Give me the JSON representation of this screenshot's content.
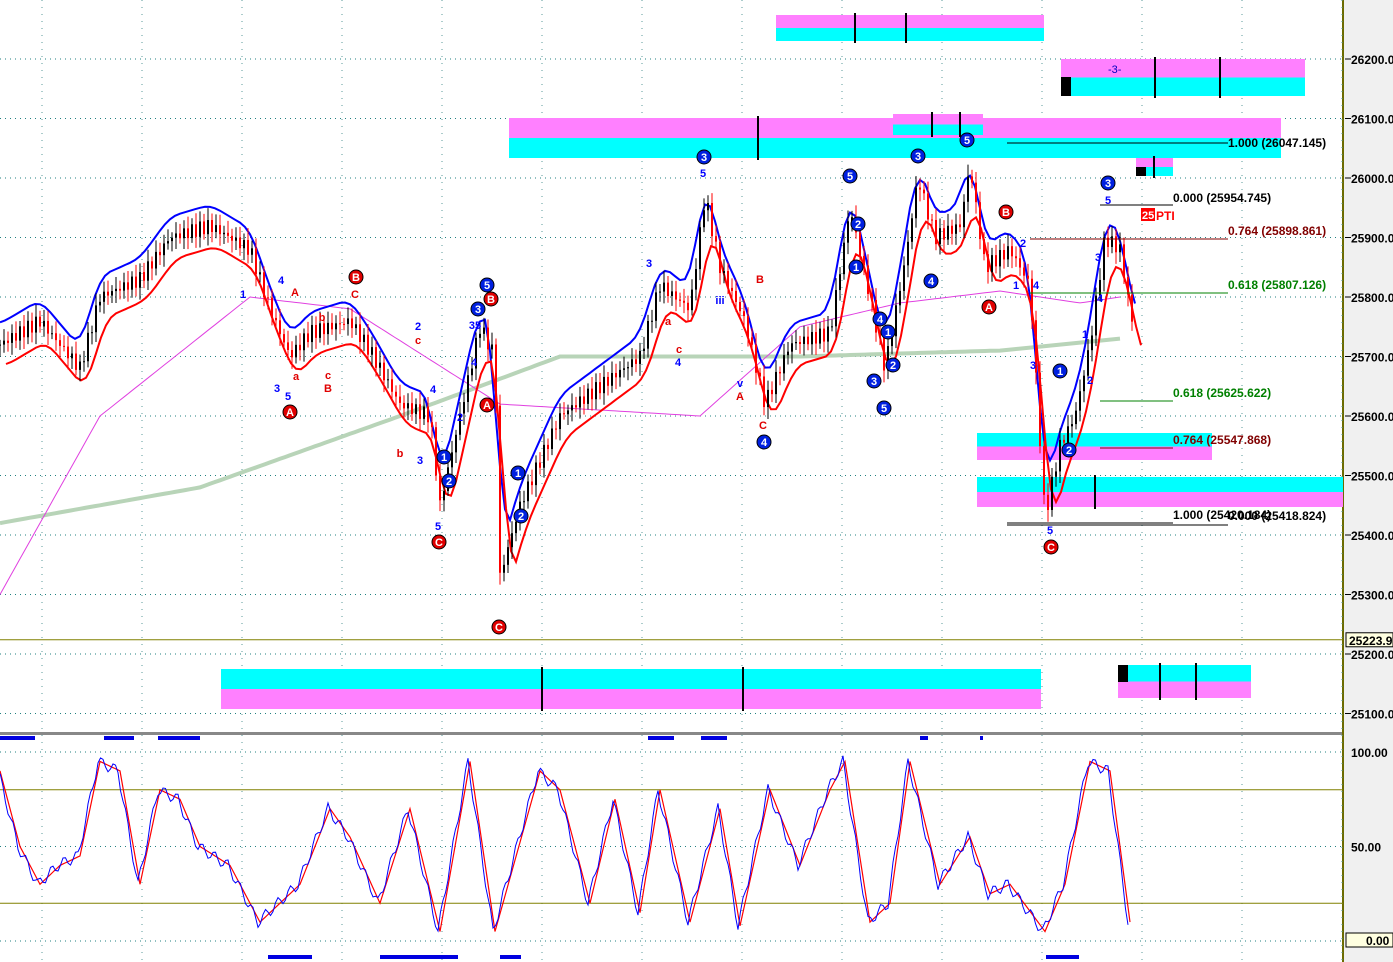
{
  "chart_data": {
    "type": "candlestick",
    "price_axis": {
      "ticks": [
        "26200.0",
        "26100.0",
        "26000.0",
        "25900.0",
        "25800.0",
        "25700.0",
        "25600.0",
        "25500.0",
        "25400.0",
        "25300.0",
        "25200.0",
        "25100.0"
      ],
      "tick_values": [
        26200,
        26100,
        26000,
        25900,
        25800,
        25700,
        25600,
        25500,
        25400,
        25300,
        25200,
        25100
      ],
      "last_price": "25223.9"
    },
    "osc_axis": {
      "ticks": [
        "100.00",
        "50.00"
      ],
      "tick_values": [
        100,
        50
      ],
      "last_value": "0.00",
      "levels": [
        80,
        20
      ]
    },
    "price_series": [
      [
        0,
        25720
      ],
      [
        4,
        25760
      ],
      [
        8,
        25680
      ],
      [
        10,
        25800
      ],
      [
        14,
        25830
      ],
      [
        17,
        25900
      ],
      [
        21,
        25920
      ],
      [
        25,
        25880
      ],
      [
        27,
        25780
      ],
      [
        29,
        25700
      ],
      [
        31,
        25740
      ],
      [
        35,
        25760
      ],
      [
        37,
        25710
      ],
      [
        40,
        25620
      ],
      [
        43,
        25600
      ],
      [
        44,
        25450
      ],
      [
        46,
        25600
      ],
      [
        48,
        25750
      ],
      [
        49.5,
        25700
      ],
      [
        50,
        25330
      ],
      [
        52,
        25450
      ],
      [
        56,
        25600
      ],
      [
        60,
        25650
      ],
      [
        64,
        25700
      ],
      [
        66,
        25820
      ],
      [
        69,
        25780
      ],
      [
        70.5,
        25970
      ],
      [
        72,
        25850
      ],
      [
        74.5,
        25760
      ],
      [
        76.5,
        25620
      ],
      [
        79,
        25720
      ],
      [
        83,
        25740
      ],
      [
        85,
        25950
      ],
      [
        87,
        25800
      ],
      [
        88.5,
        25680
      ],
      [
        90.5,
        25860
      ],
      [
        91.8,
        26000
      ],
      [
        93.5,
        25900
      ],
      [
        96,
        25920
      ],
      [
        97,
        26020
      ],
      [
        98.5,
        25850
      ],
      [
        101,
        25880
      ],
      [
        103,
        25820
      ],
      [
        104.5,
        25430
      ],
      [
        106,
        25550
      ],
      [
        107.5,
        25600
      ],
      [
        109,
        25720
      ],
      [
        110.5,
        25900
      ],
      [
        112,
        25880
      ],
      [
        113.5,
        25730
      ]
    ],
    "ma_slow": [
      [
        0,
        25420
      ],
      [
        20,
        25480
      ],
      [
        40,
        25600
      ],
      [
        56,
        25700
      ],
      [
        80,
        25700
      ],
      [
        100,
        25710
      ],
      [
        112,
        25730
      ]
    ],
    "ma_magenta": [
      [
        0,
        25300
      ],
      [
        10,
        25600
      ],
      [
        25,
        25800
      ],
      [
        35,
        25780
      ],
      [
        50,
        25620
      ],
      [
        70,
        25600
      ],
      [
        80,
        25750
      ],
      [
        90,
        25790
      ],
      [
        100,
        25810
      ],
      [
        108,
        25790
      ],
      [
        112,
        25800
      ]
    ],
    "oscillator": [
      [
        0,
        90
      ],
      [
        2,
        50
      ],
      [
        4,
        30
      ],
      [
        6,
        40
      ],
      [
        8,
        45
      ],
      [
        10,
        95
      ],
      [
        12,
        90
      ],
      [
        14,
        30
      ],
      [
        16,
        80
      ],
      [
        18,
        75
      ],
      [
        20,
        50
      ],
      [
        23,
        40
      ],
      [
        26,
        10
      ],
      [
        30,
        30
      ],
      [
        33,
        70
      ],
      [
        35,
        55
      ],
      [
        38,
        20
      ],
      [
        41,
        70
      ],
      [
        44,
        5
      ],
      [
        47,
        95
      ],
      [
        49.5,
        5
      ],
      [
        54,
        90
      ],
      [
        56,
        80
      ],
      [
        59,
        20
      ],
      [
        61.5,
        75
      ],
      [
        64,
        15
      ],
      [
        66,
        80
      ],
      [
        69,
        10
      ],
      [
        72,
        70
      ],
      [
        74,
        8
      ],
      [
        77,
        80
      ],
      [
        80,
        40
      ],
      [
        83,
        80
      ],
      [
        84.5,
        95
      ],
      [
        87,
        10
      ],
      [
        89,
        20
      ],
      [
        91,
        95
      ],
      [
        94,
        30
      ],
      [
        97,
        55
      ],
      [
        99,
        25
      ],
      [
        101,
        30
      ],
      [
        104.5,
        5
      ],
      [
        106.5,
        30
      ],
      [
        109,
        95
      ],
      [
        111,
        90
      ],
      [
        113,
        10
      ]
    ],
    "fib_levels": [
      {
        "label": "1.000 (26047.145)",
        "color": "#000000"
      },
      {
        "label": "0.000 (25954.745)",
        "color": "#000000"
      },
      {
        "label": "0.764 (25898.861)",
        "color": "#800000"
      },
      {
        "label": "0.618 (25807.126)",
        "color": "#008000"
      },
      {
        "label": "0.618 (25625.622)",
        "color": "#008000"
      },
      {
        "label": "0.764 (25547.868)",
        "color": "#800000"
      },
      {
        "label": "1.000 (25420.184)",
        "color": "#000000"
      },
      {
        "label": "0.000 (25418.824)",
        "color": "#000000"
      }
    ],
    "annotations": {
      "cycle_label": "-3-",
      "pti": "25",
      "pti_suffix": "PTI"
    },
    "wave_labels": [
      "3",
      "5",
      "5",
      "2",
      "1",
      "3",
      "5",
      "4",
      "4",
      "1",
      "2",
      "3",
      "5",
      "B",
      "A",
      "3",
      "5",
      "1",
      "2",
      "C",
      "5",
      "4",
      "C",
      "A",
      "v",
      "B",
      "5",
      "B",
      "3",
      "A",
      "1",
      "2",
      "C",
      "C",
      "5",
      "1",
      "2",
      "3",
      "b",
      "c",
      "2",
      "B",
      "C",
      "B",
      "c",
      "b",
      "A",
      "5",
      "3",
      "A",
      "1",
      "4",
      "a",
      "3",
      "a",
      "c",
      "4",
      "iii",
      "1",
      "4",
      "3",
      "2",
      "3",
      "4",
      "1",
      "2",
      "35",
      "4",
      "2",
      "4"
    ],
    "colors": {
      "up": "#000000",
      "down": "#ff0000",
      "envelope_upper": "#0000ff",
      "envelope_lower": "#ff0000",
      "ma_slow": "#b8d4b8",
      "ma_magenta": "#e040e0",
      "cyan": "#00ffff",
      "magenta": "#ff80ff"
    }
  }
}
